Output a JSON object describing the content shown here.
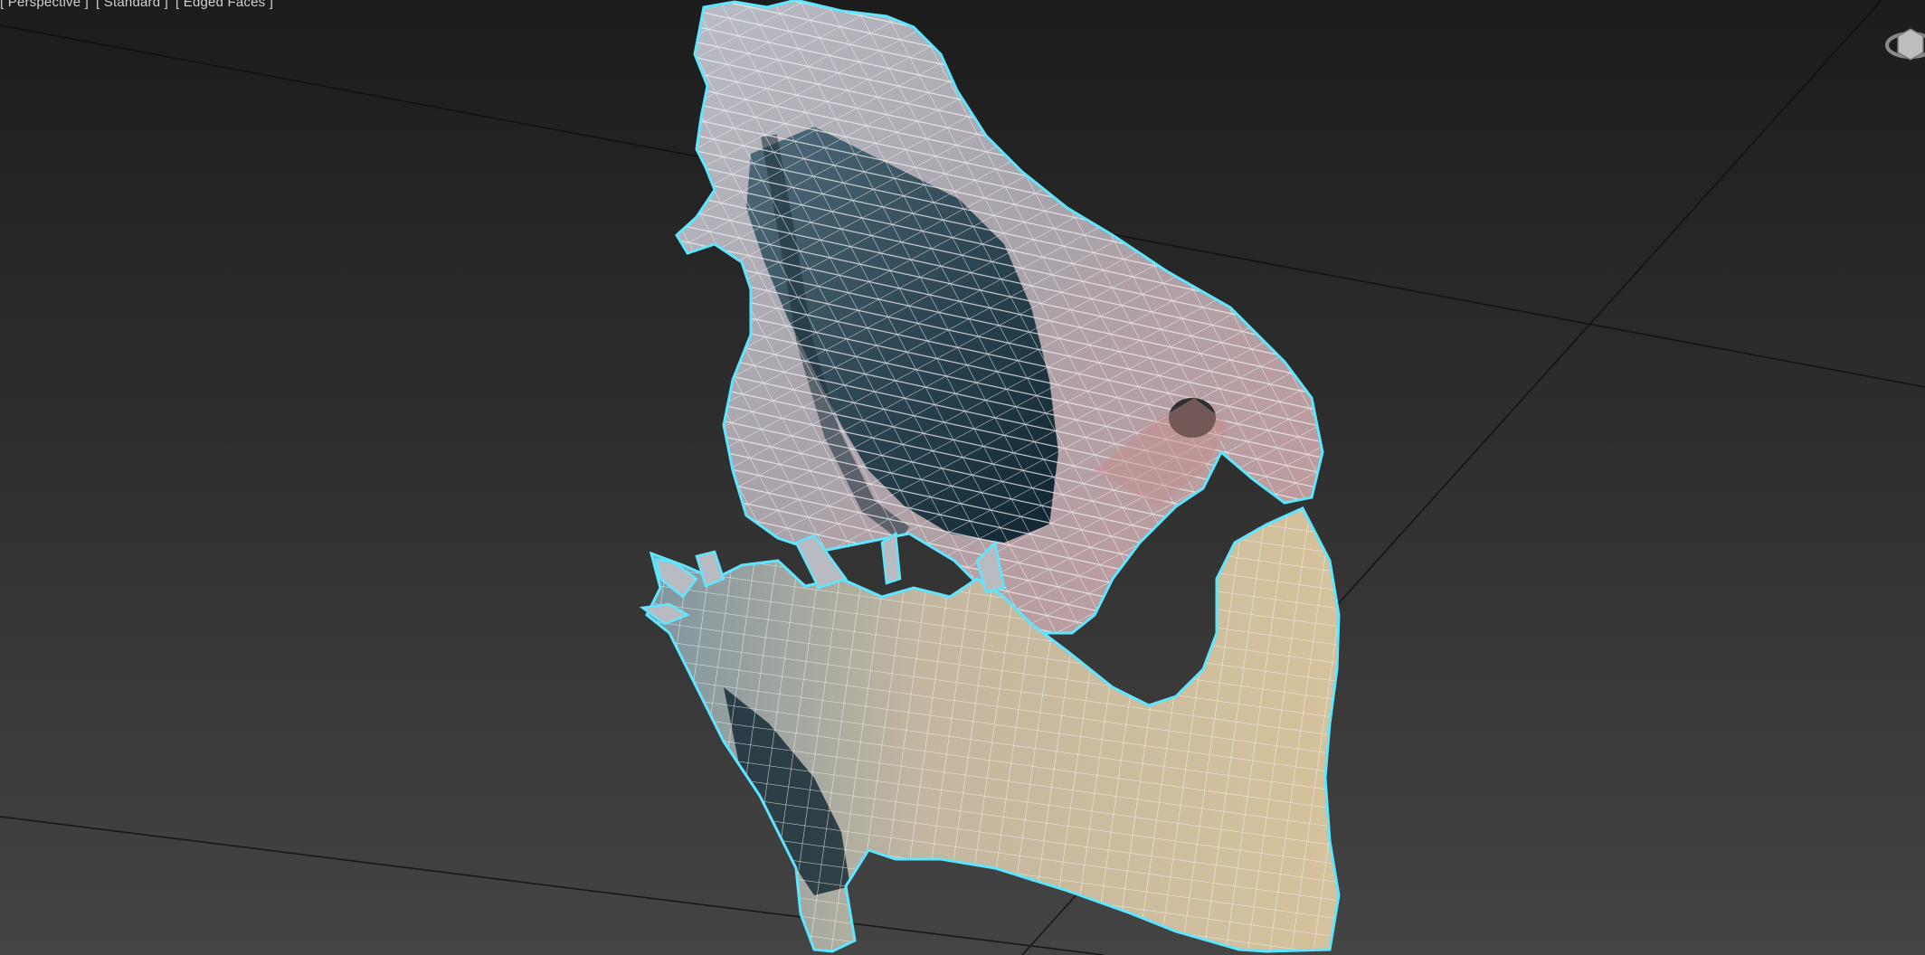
{
  "viewport": {
    "label_segments": [
      "[ Perspective ]",
      "[ Standard ]",
      "[ Edged Faces ]"
    ],
    "shading_mode": "Edged Faces",
    "selection_color": "#5fe6ff",
    "wire_color": "#f2f2f2",
    "background_top": "#1c1c1c",
    "background_bottom": "#444444"
  },
  "scene": {
    "object": "jaw-skull-mesh",
    "selected": true
  },
  "icons": {
    "viewcube": "viewcube-icon"
  }
}
